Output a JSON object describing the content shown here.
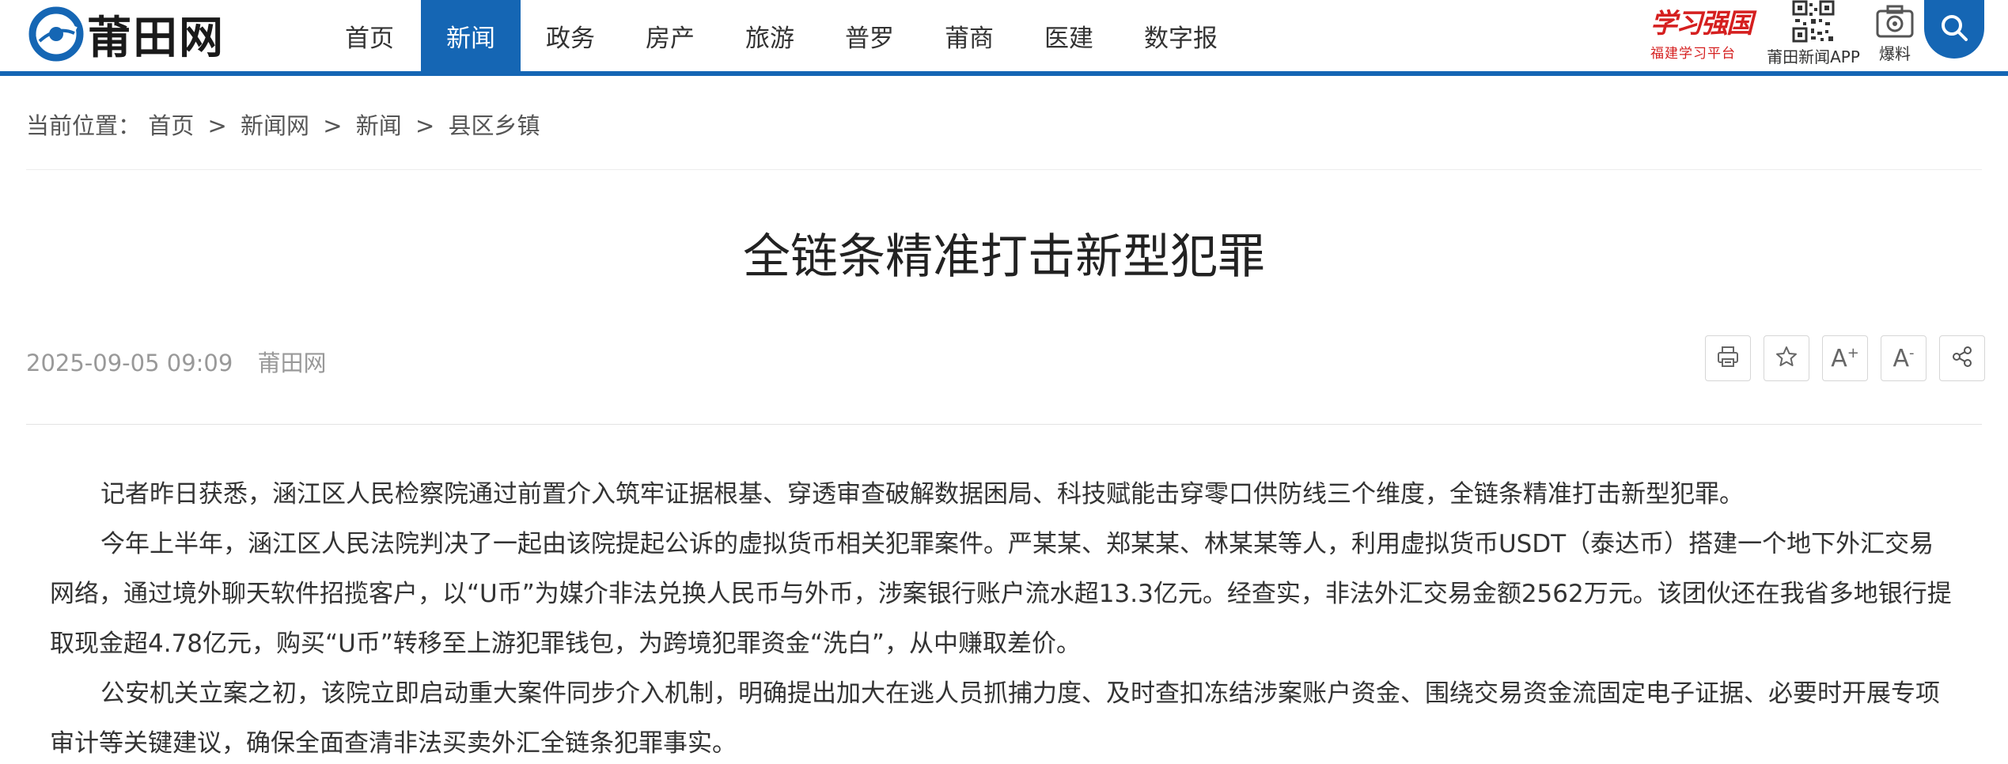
{
  "site": {
    "logo_text": "莆田网",
    "brand_color": "#1566b4"
  },
  "nav": {
    "items": [
      {
        "label": "首页",
        "active": false
      },
      {
        "label": "新闻",
        "active": true
      },
      {
        "label": "政务",
        "active": false
      },
      {
        "label": "房产",
        "active": false
      },
      {
        "label": "旅游",
        "active": false
      },
      {
        "label": "普罗",
        "active": false
      },
      {
        "label": "莆商",
        "active": false
      },
      {
        "label": "医建",
        "active": false
      },
      {
        "label": "数字报",
        "active": false
      }
    ]
  },
  "tools": {
    "xuexi_title": "学习强国",
    "xuexi_subtitle": "福建学习平台",
    "app_label": "莆田新闻APP",
    "baoliao_label": "爆料",
    "search_icon": "search-icon"
  },
  "breadcrumb": {
    "prefix": "当前位置：",
    "items": [
      "首页",
      "新闻网",
      "新闻",
      "县区乡镇"
    ],
    "separator": ">"
  },
  "article": {
    "title": "全链条精准打击新型犯罪",
    "date": "2025-09-05 09:09",
    "source": "莆田网",
    "paragraphs": [
      "记者昨日获悉，涵江区人民检察院通过前置介入筑牢证据根基、穿透审查破解数据困局、科技赋能击穿零口供防线三个维度，全链条精准打击新型犯罪。",
      "今年上半年，涵江区人民法院判决了一起由该院提起公诉的虚拟货币相关犯罪案件。严某某、郑某某、林某某等人，利用虚拟货币USDT（泰达币）搭建一个地下外汇交易网络，通过境外聊天软件招揽客户，以“U币”为媒介非法兑换人民币与外币，涉案银行账户流水超13.3亿元。经查实，非法外汇交易金额2562万元。该团伙还在我省多地银行提取现金超4.78亿元，购买“U币”转移至上游犯罪钱包，为跨境犯罪资金“洗白”，从中赚取差价。",
      "公安机关立案之初，该院立即启动重大案件同步介入机制，明确提出加大在逃人员抓捕力度、及时查扣冻结涉案账户资金、围绕交易资金流固定电子证据、必要时开展专项审计等关键建议，确保全面查清非法买卖外汇全链条犯罪事实。"
    ]
  },
  "actions": [
    {
      "name": "print-icon"
    },
    {
      "name": "star-icon"
    },
    {
      "name": "font-increase-icon",
      "text": "A",
      "mark": "+"
    },
    {
      "name": "font-decrease-icon",
      "text": "A",
      "mark": "-"
    },
    {
      "name": "share-icon"
    }
  ]
}
